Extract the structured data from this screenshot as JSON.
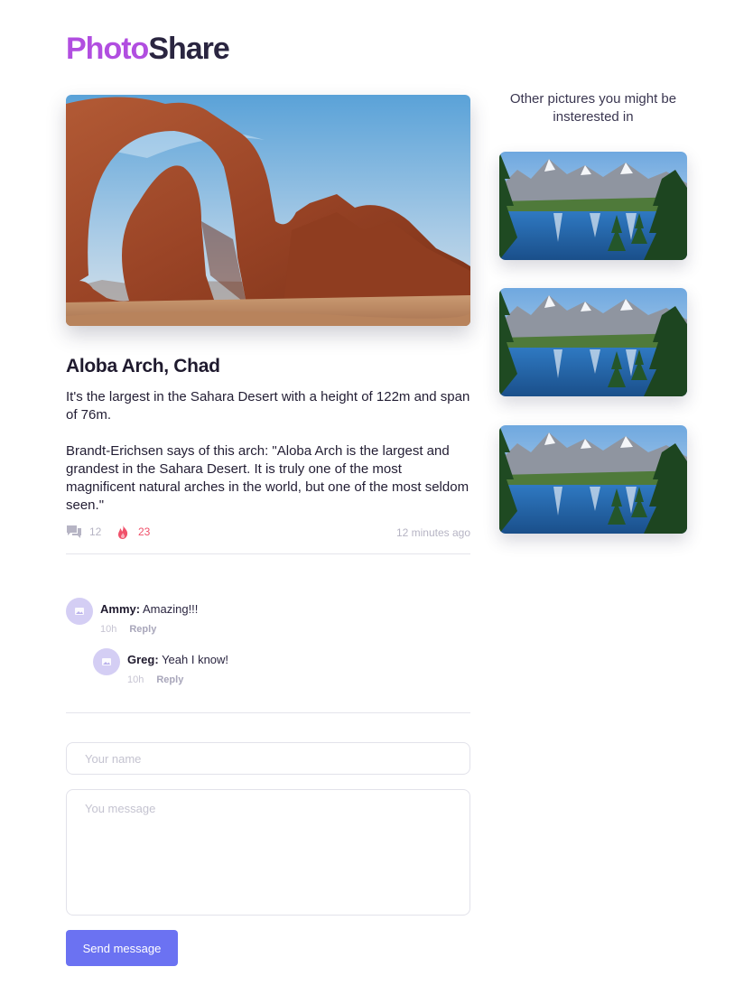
{
  "logo": {
    "part1": "Photo",
    "part2": "Share"
  },
  "post": {
    "title": "Aloba Arch, Chad",
    "paragraph1": "It's the largest in the Sahara Desert with a height of 122m and span of 76m.",
    "paragraph2": "Brandt-Erichsen says of this arch: \"Aloba Arch is the largest and grandest in the Sahara Desert. It is truly one of the most magnificent natural arches in the world, but one of the most seldom seen.\"",
    "comment_count": "12",
    "like_count": "23",
    "time": "12 minutes ago"
  },
  "comments": [
    {
      "author": "Ammy:",
      "text": "Amazing!!!",
      "time": "10h",
      "reply_label": "Reply"
    },
    {
      "author": "Greg:",
      "text": "Yeah I know!",
      "time": "10h",
      "reply_label": "Reply"
    }
  ],
  "form": {
    "name_placeholder": "Your name",
    "message_placeholder": "You message",
    "send_label": "Send message"
  },
  "sidebar": {
    "title": "Other pictures you might be insterested in"
  },
  "colors": {
    "brand_purple": "#b14ee0",
    "brand_dark": "#2a2540",
    "button": "#6b72f2",
    "like": "#f0506a",
    "avatar": "#d4cef4"
  },
  "icons": {
    "comments": "comments-icon",
    "likes": "flame-icon",
    "avatar": "image-placeholder-icon"
  }
}
